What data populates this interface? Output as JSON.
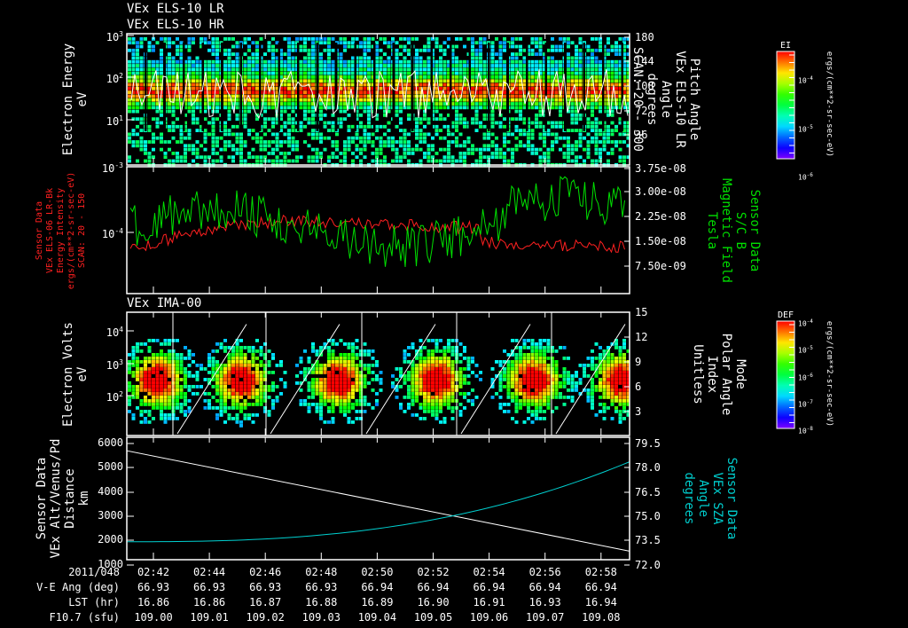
{
  "panel_titles": [
    "VEx ELS-10 LR",
    "VEx ELS-10 HR",
    "VEx IMA-00"
  ],
  "chart_data": [
    {
      "type": "heatmap",
      "name": "els-spectrogram",
      "ylabel": [
        "Electron Energy",
        "eV"
      ],
      "yticks": [
        "10^3",
        "10^2",
        "10^1"
      ],
      "ylim": [
        1,
        1000
      ],
      "right_ylabel": [
        "Pitch Angle",
        "VEx ELS-10 LR",
        "Angle",
        "degrees",
        "SCAN: 20 - 300"
      ],
      "right_yticks": [
        "180",
        "144",
        "108",
        "72",
        "36"
      ],
      "colorbar": {
        "title": "EI",
        "ticks": [
          "10^-4",
          "10^-5",
          "10^-6"
        ],
        "units": "ergs/(cm**2-sr-sec-eV)"
      }
    },
    {
      "type": "line",
      "name": "energy-intensity-and-mag",
      "ylabel": [
        "Sensor Data",
        "VEx ELS-06 LR-Bk",
        "Energy Intensity",
        "ergs/(cm**2-sr-sec-eV)",
        "SCAN: 20 - 150"
      ],
      "yticks": [
        "10^-3",
        "10^-4"
      ],
      "ylim": [
        1e-05,
        0.001
      ],
      "right_ylabel": [
        "Sensor Data",
        "S/C B",
        "Magnetic Field",
        "Tesla"
      ],
      "right_yticks": [
        "3.75e-08",
        "3.00e-08",
        "2.25e-08",
        "1.50e-08",
        "7.50e-09"
      ],
      "right_ylim": [
        0,
        3.75e-08
      ],
      "series": [
        {
          "name": "Energy Intensity",
          "color": "#ff2020"
        },
        {
          "name": "Magnetic Field",
          "color": "#00e000"
        }
      ]
    },
    {
      "type": "heatmap",
      "name": "ima-spectrogram",
      "ylabel": [
        "Electron Volts",
        "eV"
      ],
      "yticks": [
        "10^4",
        "10^3",
        "10^2"
      ],
      "right_ylabel": [
        "Mode",
        "Polar Angle",
        "Index",
        "Unitless"
      ],
      "right_yticks": [
        "15",
        "12",
        "9",
        "6",
        "3"
      ],
      "colorbar": {
        "title": "DEF",
        "ticks": [
          "10^-4",
          "10^-5",
          "10^-6",
          "10^-7",
          "10^-8"
        ],
        "units": "ergs/(cm**2-sr-sec-eV)"
      }
    },
    {
      "type": "line",
      "name": "altitude-and-sza",
      "ylabel": [
        "Sensor Data",
        "VEx Alt/Venus/Pd",
        "Distance",
        "km"
      ],
      "yticks": [
        "6000",
        "5000",
        "4000",
        "3000",
        "2000",
        "1000"
      ],
      "ylim": [
        1000,
        6000
      ],
      "right_ylabel": [
        "Sensor Data",
        "VEx SZA",
        "Angle",
        "degrees"
      ],
      "right_yticks": [
        "79.5",
        "78.0",
        "76.5",
        "75.0",
        "73.5",
        "72.0"
      ],
      "right_ylim": [
        72.0,
        79.5
      ],
      "series": [
        {
          "name": "Distance",
          "color": "#ffffff",
          "x": [
            "02:41",
            "02:59"
          ],
          "y": [
            5450,
            1350
          ]
        },
        {
          "name": "SZA",
          "color": "#00d0d0",
          "x": [
            "02:41",
            "02:48",
            "02:52",
            "02:56",
            "02:59"
          ],
          "y": [
            73.1,
            73.4,
            74.2,
            75.9,
            78.0
          ]
        }
      ]
    }
  ],
  "x_axis": {
    "date": "2011/048",
    "times": [
      "02:42",
      "02:44",
      "02:46",
      "02:48",
      "02:50",
      "02:52",
      "02:54",
      "02:56",
      "02:58"
    ],
    "rows": [
      {
        "label": "V-E Ang (deg)",
        "values": [
          "66.93",
          "66.93",
          "66.93",
          "66.93",
          "66.94",
          "66.94",
          "66.94",
          "66.94",
          "66.94"
        ]
      },
      {
        "label": "LST (hr)",
        "values": [
          "16.86",
          "16.86",
          "16.87",
          "16.88",
          "16.89",
          "16.90",
          "16.91",
          "16.93",
          "16.94"
        ]
      },
      {
        "label": "F10.7 (sfu)",
        "values": [
          "109.00",
          "109.01",
          "109.02",
          "109.03",
          "109.04",
          "109.05",
          "109.06",
          "109.07",
          "109.08"
        ]
      }
    ]
  }
}
